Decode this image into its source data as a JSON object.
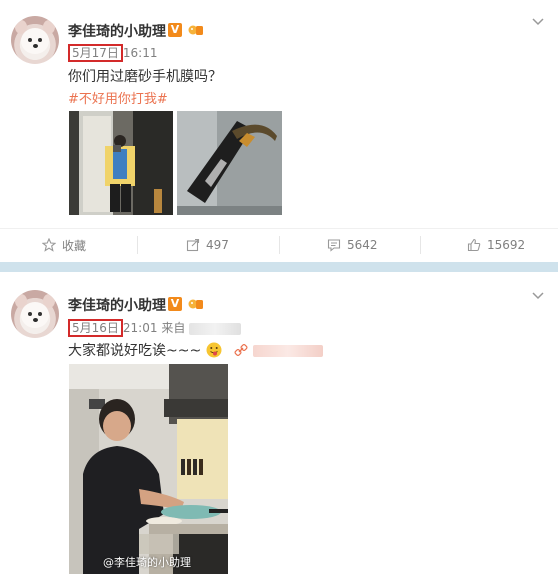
{
  "post1": {
    "author": "李佳琦的小助理",
    "v_badge": "V",
    "date": "5月17日",
    "time": "16:11",
    "text": "你们用过磨砂手机膜吗？",
    "hashtag": "#不好用你打我#",
    "actions": {
      "favorite": "收藏",
      "repost": "497",
      "comment": "5642",
      "like": "15692"
    }
  },
  "post2": {
    "author": "李佳琦的小助理",
    "v_badge": "V",
    "date": "5月16日",
    "time": "21:01",
    "source_prefix": "来自",
    "text": "大家都说好吃诶~~~",
    "watermark": "@李佳琦的小助理"
  },
  "colors": {
    "date_highlight": "#d32a2a",
    "hashtag": "#eb7350",
    "divider": "#cfe2ec"
  }
}
